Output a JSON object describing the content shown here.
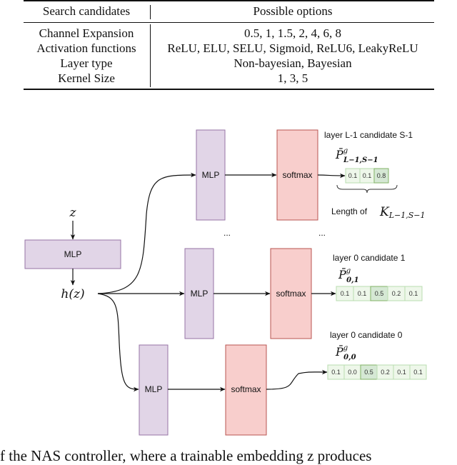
{
  "table": {
    "headers": [
      "Search candidates",
      "Possible options"
    ],
    "rows": [
      {
        "candidate": "Channel Expansion",
        "options": "0.5, 1, 1.5, 2, 4, 6, 8"
      },
      {
        "candidate": "Activation functions",
        "options": "ReLU, ELU, SELU, Sigmoid, ReLU6, LeakyReLU"
      },
      {
        "candidate": "Layer type",
        "options": "Non-bayesian, Bayesian"
      },
      {
        "candidate": "Kernel Size",
        "options": "1, 3, 5"
      }
    ]
  },
  "diagram": {
    "input_label": "z",
    "embed_block": "MLP",
    "hidden_label": "h(z)",
    "ellipsis": "...",
    "colors": {
      "mlp_fill": "#e1d5e7",
      "mlp_stroke": "#9673a6",
      "softmax_fill": "#f8cecc",
      "softmax_stroke": "#b85450",
      "prob_fill": "#eef7ea",
      "prob_stroke": "#b9dcb0",
      "prob_highlight_fill": "#d5e8d4",
      "prob_highlight_stroke": "#82b366"
    },
    "branches": [
      {
        "id": "top",
        "title": "layer L-1 candidate S-1",
        "mlp_label": "MLP",
        "softmax_label": "softmax",
        "prob_symbol": "P̄",
        "prob_sup": "g",
        "prob_sub": "L−1,S−1",
        "probs": [
          "0.1",
          "0.1",
          "0.8"
        ],
        "highlight_index": 2,
        "brace_label": "Length of",
        "brace_symbol": "K",
        "brace_sub": "L−1,S−1"
      },
      {
        "id": "middle",
        "title": "layer 0 candidate 1",
        "mlp_label": "MLP",
        "softmax_label": "softmax",
        "prob_symbol": "P̄",
        "prob_sup": "g",
        "prob_sub": "0,1",
        "probs": [
          "0.1",
          "0.1",
          "0.5",
          "0.2",
          "0.1"
        ],
        "highlight_index": 2
      },
      {
        "id": "bottom",
        "title": "layer 0 candidate 0",
        "mlp_label": "MLP",
        "softmax_label": "softmax",
        "prob_symbol": "P̄",
        "prob_sup": "g",
        "prob_sub": "0,0",
        "probs": [
          "0.1",
          "0.0",
          "0.5",
          "0.2",
          "0.1",
          "0.1"
        ],
        "highlight_index": 2
      }
    ]
  },
  "caption": "f the NAS controller, where a trainable embedding z produces"
}
